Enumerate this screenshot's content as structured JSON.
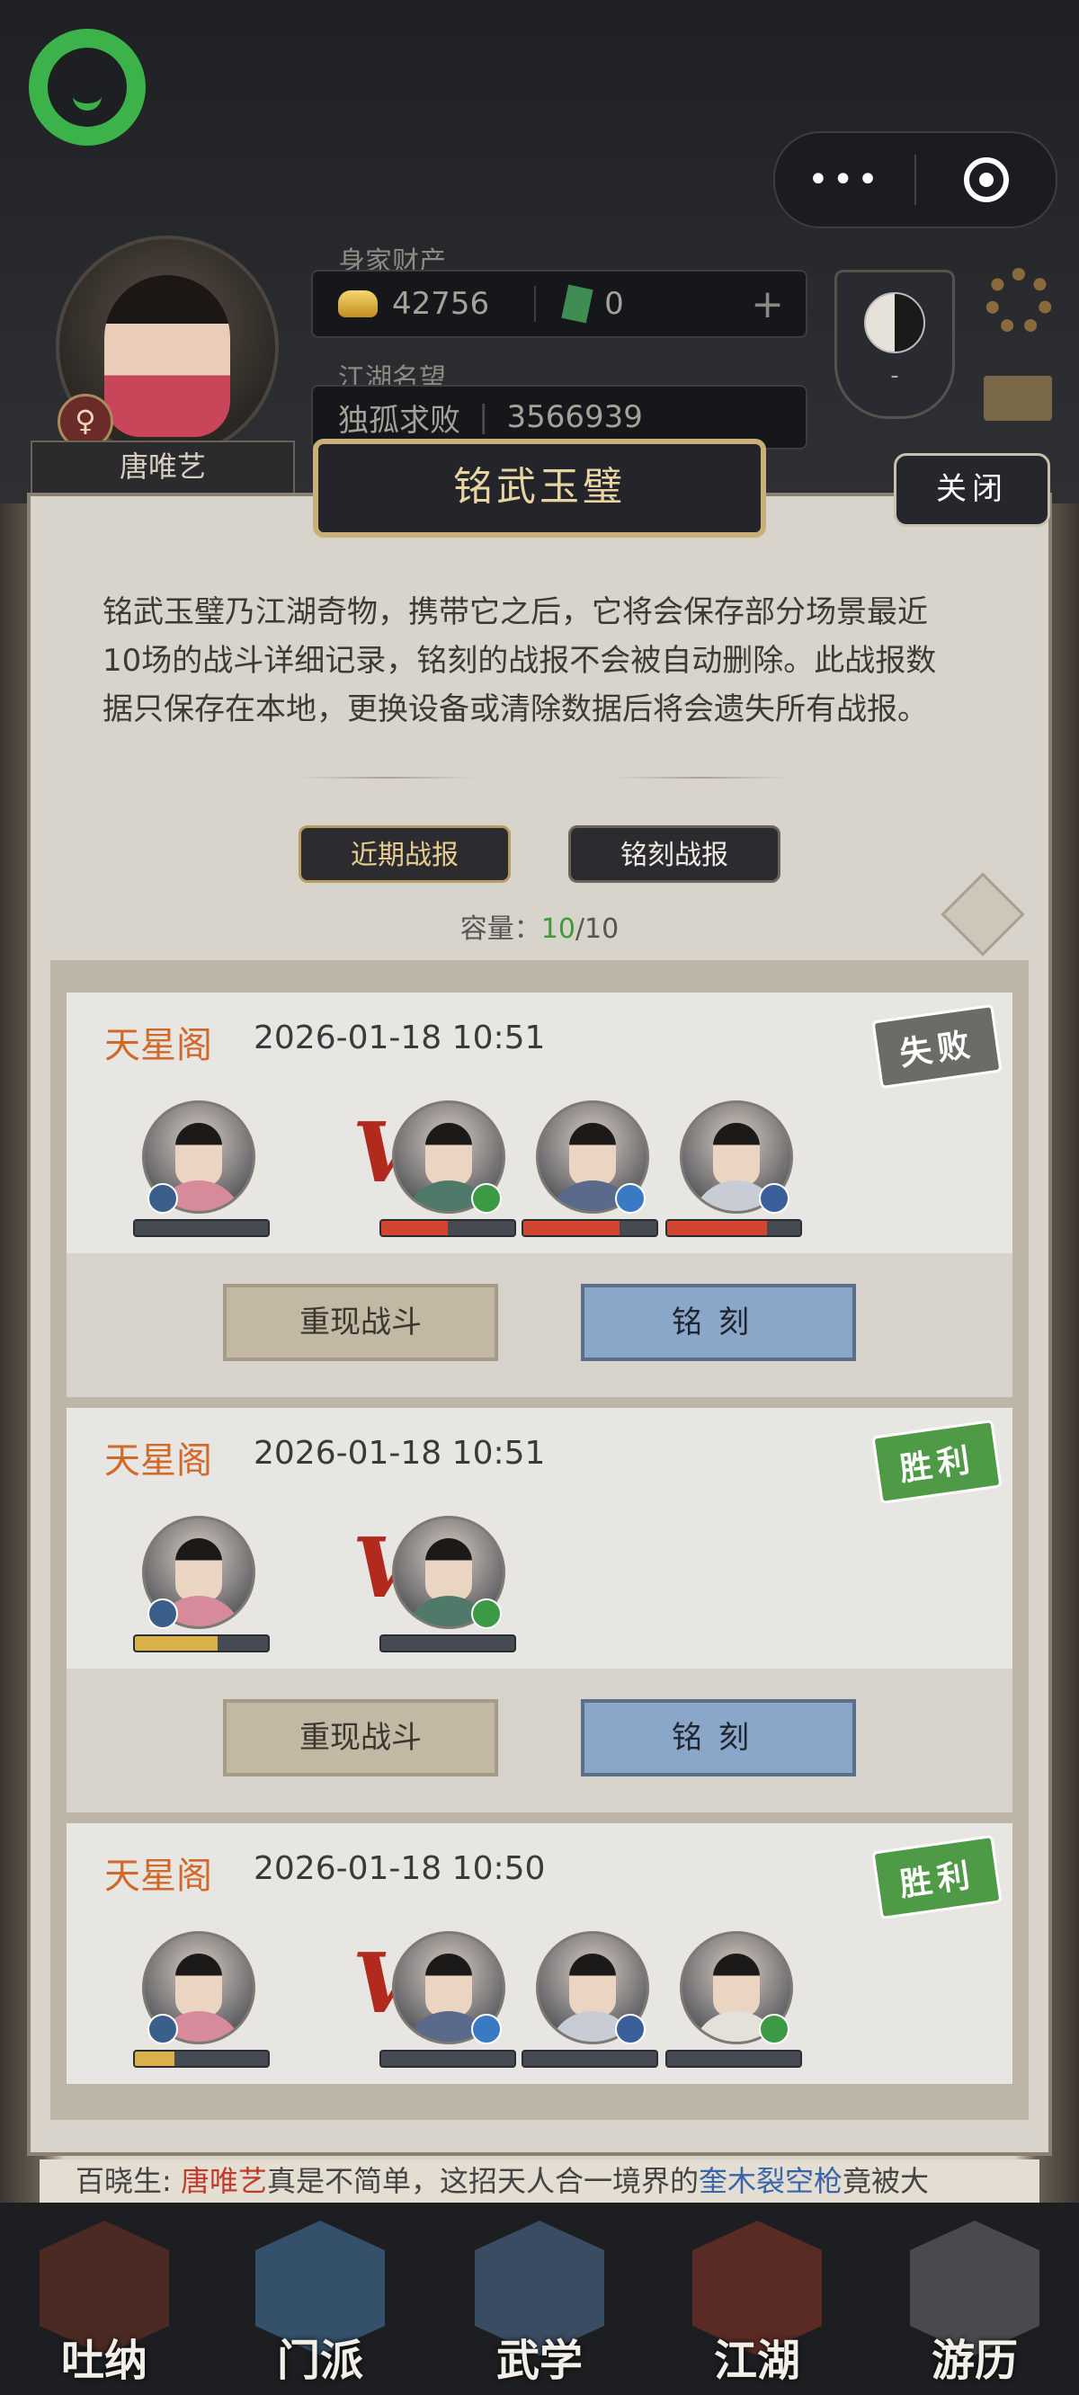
{
  "header": {
    "assets_label": "身家财产",
    "gold": "42756",
    "jade": "0",
    "fame_label": "江湖名望",
    "fame_title": "独孤求败",
    "fame_value": "3566939",
    "player_name": "唐唯艺",
    "gender_symbol": "♀",
    "taiji_mark": "-"
  },
  "capsule": {
    "more": "•••"
  },
  "dialog": {
    "title": "铭武玉璧",
    "close_label": "关闭",
    "description": "铭武玉璧乃江湖奇物，携带它之后，它将会保存部分场景最近10场的战斗详细记录，铭刻的战报不会被自动删除。此战报数据只保存在本地，更换设备或清除数据后将会遗失所有战报。",
    "tabs": [
      "近期战报",
      "铭刻战报"
    ],
    "capacity_label": "容量：",
    "capacity_current": "10",
    "capacity_max": "/10"
  },
  "battles": [
    {
      "location": "天星阁",
      "time": "2026-01-18 10:51",
      "result": "失败",
      "player_hp": 0,
      "enemies_hp": [
        0.5,
        0.72,
        0.75
      ],
      "vs": "VS",
      "replay_label": "重现战斗",
      "engrave_label": "铭刻"
    },
    {
      "location": "天星阁",
      "time": "2026-01-18 10:51",
      "result": "胜利",
      "player_hp": 0.62,
      "enemies_hp": [
        0
      ],
      "vs": "VS",
      "replay_label": "重现战斗",
      "engrave_label": "铭刻"
    },
    {
      "location": "天星阁",
      "time": "2026-01-18 10:50",
      "result": "胜利",
      "player_hp": 0.3,
      "enemies_hp": [
        0,
        0,
        0
      ],
      "vs": "VS"
    }
  ],
  "ticker": {
    "prefix": "百晓生:",
    "name": "唐唯艺",
    "middle": "真是不简单，这招天人合一境界的",
    "skill": "奎木裂空枪",
    "suffix": "竟被大"
  },
  "nav": [
    "吐纳",
    "门派",
    "武学",
    "江湖",
    "游历"
  ],
  "colors": {
    "hp_red": "#d2452f",
    "hp_gold": "#d9b04a",
    "win_green": "#4e9a46",
    "lose_gray": "#6d6b66",
    "guild_orange": "#d06a2a",
    "capacity_green": "#3e9a3a"
  }
}
